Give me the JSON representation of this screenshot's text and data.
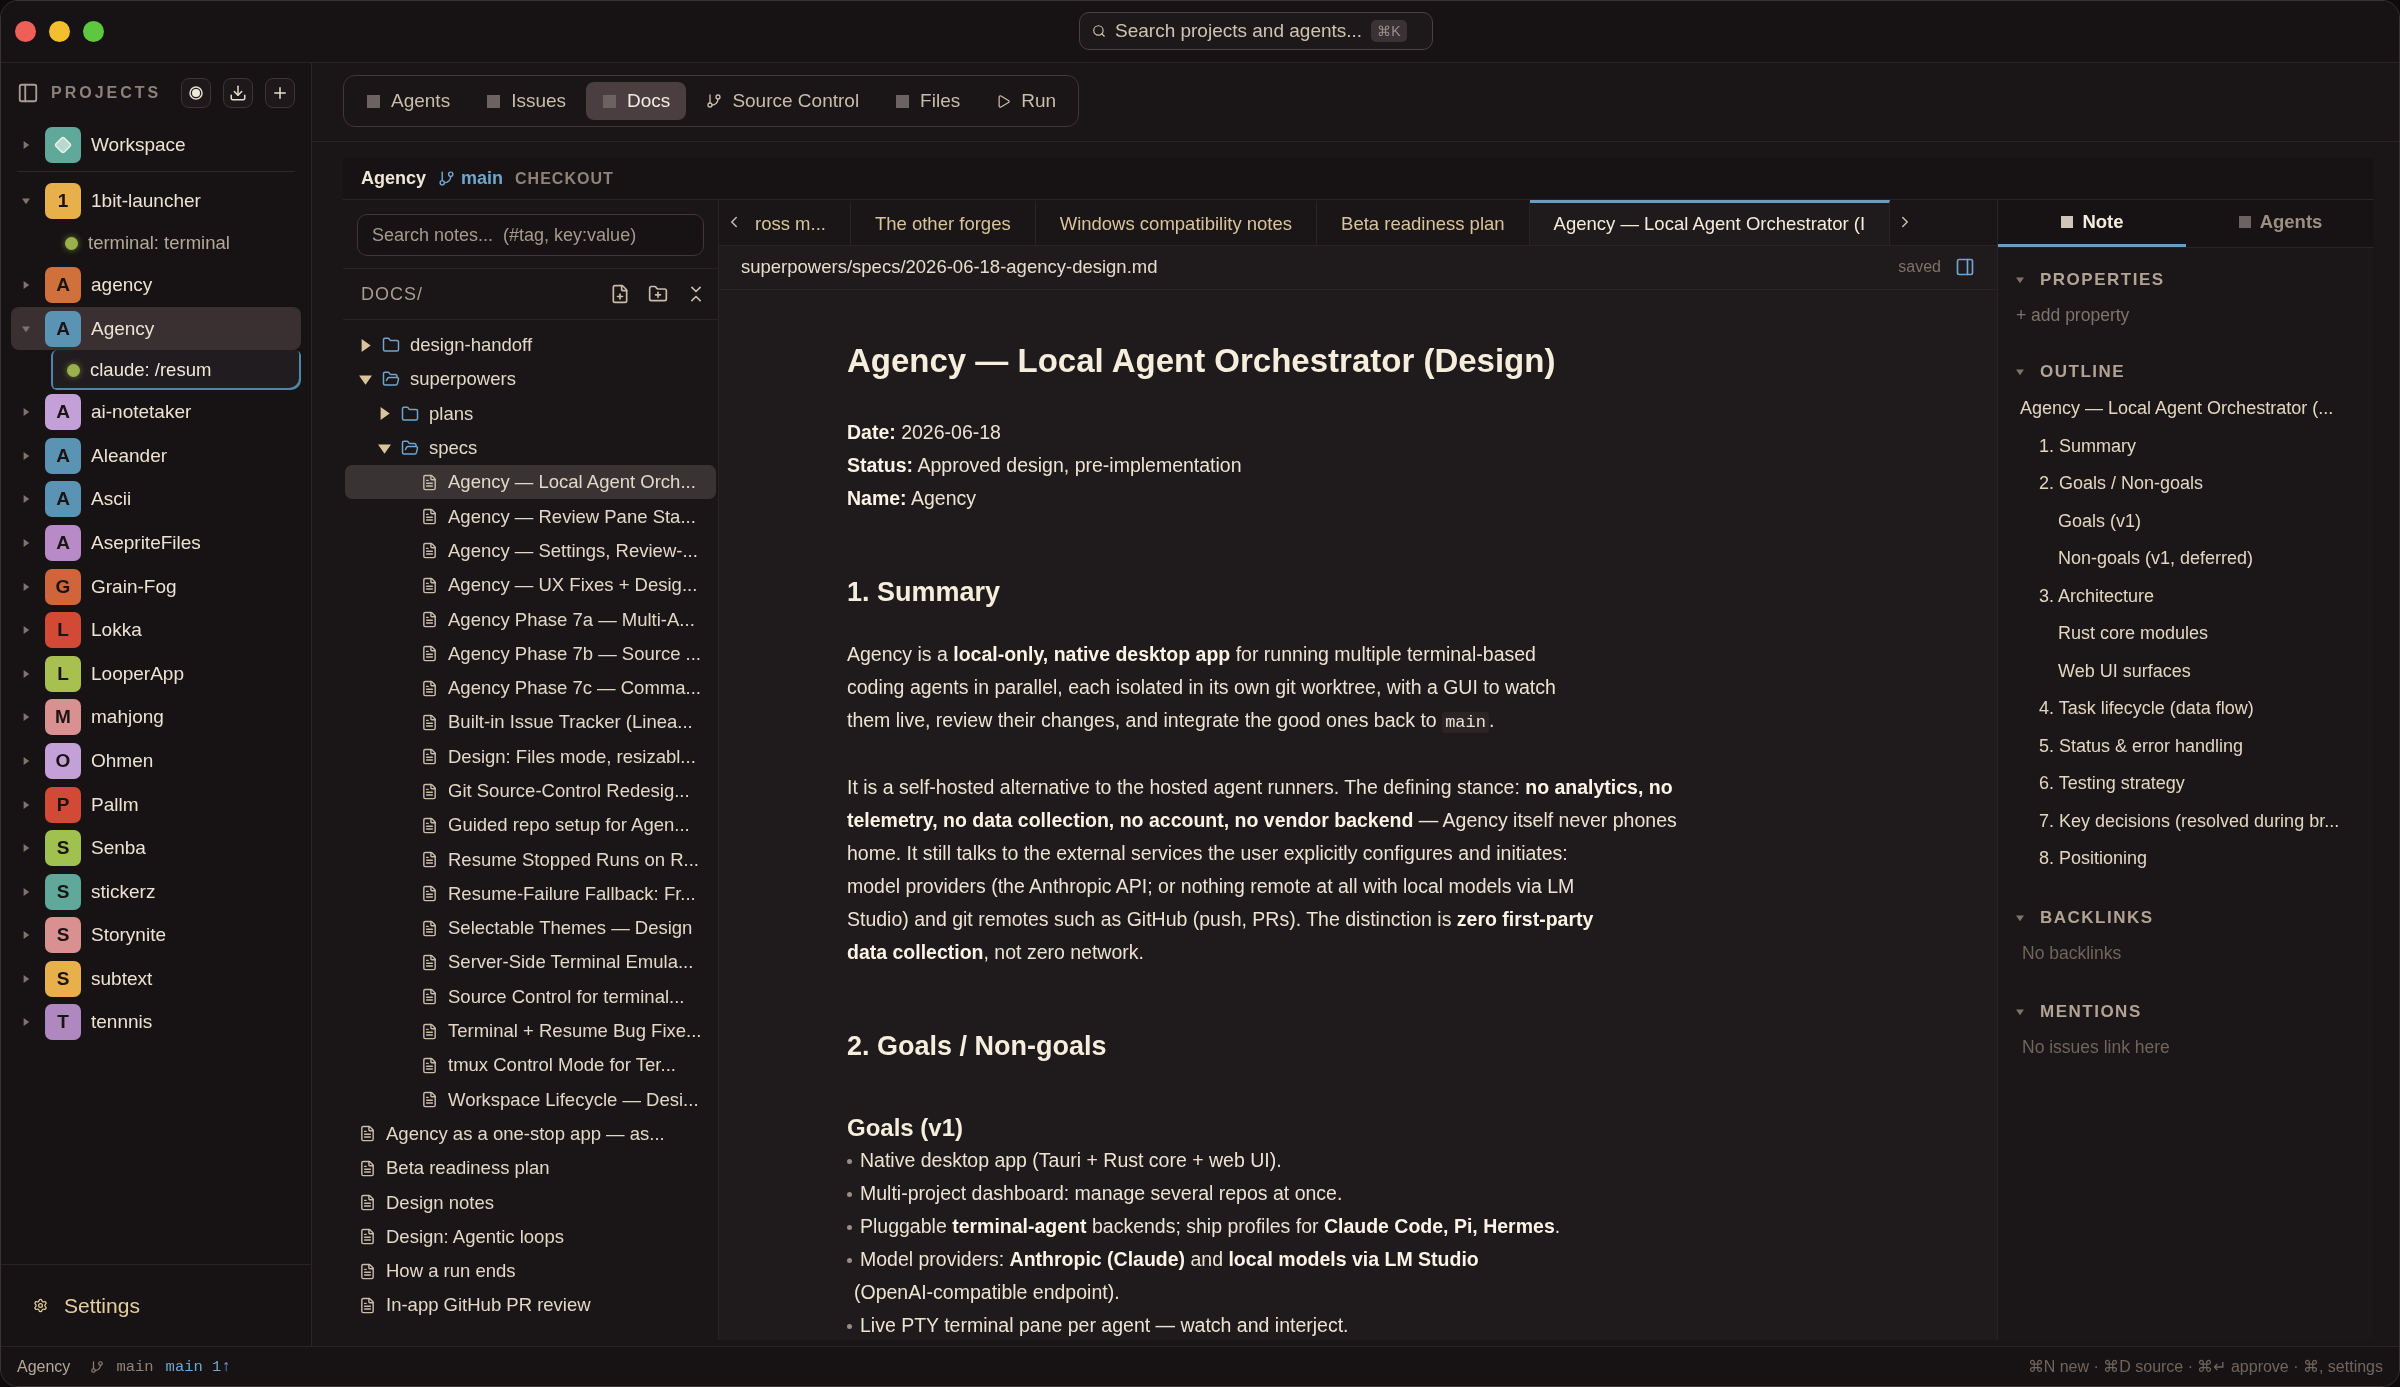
{
  "title_bar": {
    "search": {
      "placeholder": "Search projects and agents...",
      "shortcut": "⌘K"
    }
  },
  "sidebar": {
    "heading": "PROJECTS",
    "projects": [
      {
        "kind": "workspace",
        "name": "Workspace",
        "color": "#5fa89a",
        "expanded": false,
        "selected": false
      },
      {
        "kind": "project",
        "letter": "1",
        "name": "1bit-launcher",
        "color": "#e8b04a",
        "expanded": true,
        "selected": false,
        "children": [
          {
            "label": "terminal: terminal",
            "selected": false
          }
        ]
      },
      {
        "kind": "project",
        "letter": "A",
        "name": "agency",
        "color": "#d0703a",
        "expanded": false,
        "selected": false
      },
      {
        "kind": "project",
        "letter": "A",
        "name": "Agency",
        "color": "#5b93b5",
        "expanded": true,
        "selected": true,
        "children": [
          {
            "label": "claude: /resum",
            "selected": true
          }
        ]
      },
      {
        "kind": "project",
        "letter": "A",
        "name": "ai-notetaker",
        "color": "#c4a0d8",
        "expanded": false,
        "selected": false
      },
      {
        "kind": "project",
        "letter": "A",
        "name": "Aleander",
        "color": "#5b93b5",
        "expanded": false,
        "selected": false
      },
      {
        "kind": "project",
        "letter": "A",
        "name": "Ascii",
        "color": "#5b93b5",
        "expanded": false,
        "selected": false
      },
      {
        "kind": "project",
        "letter": "A",
        "name": "AsepriteFiles",
        "color": "#b88ac8",
        "expanded": false,
        "selected": false
      },
      {
        "kind": "project",
        "letter": "G",
        "name": "Grain-Fog",
        "color": "#d0643a",
        "expanded": false,
        "selected": false
      },
      {
        "kind": "project",
        "letter": "L",
        "name": "Lokka",
        "color": "#d24a35",
        "expanded": false,
        "selected": false
      },
      {
        "kind": "project",
        "letter": "L",
        "name": "LooperApp",
        "color": "#a8c050",
        "expanded": false,
        "selected": false
      },
      {
        "kind": "project",
        "letter": "M",
        "name": "mahjong",
        "color": "#d89090",
        "expanded": false,
        "selected": false
      },
      {
        "kind": "project",
        "letter": "O",
        "name": "Ohmen",
        "color": "#c4a0d8",
        "expanded": false,
        "selected": false
      },
      {
        "kind": "project",
        "letter": "P",
        "name": "Pallm",
        "color": "#d24a35",
        "expanded": false,
        "selected": false
      },
      {
        "kind": "project",
        "letter": "S",
        "name": "Senba",
        "color": "#a0c050",
        "expanded": false,
        "selected": false
      },
      {
        "kind": "project",
        "letter": "S",
        "name": "stickerz",
        "color": "#5fa89a",
        "expanded": false,
        "selected": false
      },
      {
        "kind": "project",
        "letter": "S",
        "name": "Storynite",
        "color": "#d89090",
        "expanded": false,
        "selected": false
      },
      {
        "kind": "project",
        "letter": "S",
        "name": "subtext",
        "color": "#e8b04a",
        "expanded": false,
        "selected": false
      },
      {
        "kind": "project",
        "letter": "T",
        "name": "tennnis",
        "color": "#b088c0",
        "expanded": false,
        "selected": false
      }
    ],
    "settings": "Settings"
  },
  "mode_tabs": [
    {
      "label": "Agents",
      "selected": false
    },
    {
      "label": "Issues",
      "selected": false
    },
    {
      "label": "Docs",
      "selected": true
    },
    {
      "label": "Source Control",
      "selected": false
    },
    {
      "label": "Files",
      "selected": false
    },
    {
      "label": "Run",
      "selected": false
    }
  ],
  "project_header": {
    "name": "Agency",
    "branch": "main",
    "action": "CHECKOUT"
  },
  "docs": {
    "search": {
      "placeholder": "Search notes...  (#tag, key:value)"
    },
    "heading": "DOCS/",
    "tree": [
      {
        "kind": "folder",
        "name": "design-handoff",
        "expanded": false
      },
      {
        "kind": "folder",
        "name": "superpowers",
        "expanded": true,
        "children": [
          {
            "kind": "folder",
            "name": "plans",
            "expanded": false
          },
          {
            "kind": "folder",
            "name": "specs",
            "expanded": true,
            "children": [
              {
                "kind": "file",
                "name": "Agency — Local Agent Orch...",
                "selected": true
              },
              {
                "kind": "file",
                "name": "Agency — Review Pane Sta...",
                "selected": false
              },
              {
                "kind": "file",
                "name": "Agency — Settings, Review-...",
                "selected": false
              },
              {
                "kind": "file",
                "name": "Agency — UX Fixes + Desig...",
                "selected": false
              },
              {
                "kind": "file",
                "name": "Agency Phase 7a — Multi-A...",
                "selected": false
              },
              {
                "kind": "file",
                "name": "Agency Phase 7b — Source ...",
                "selected": false
              },
              {
                "kind": "file",
                "name": "Agency Phase 7c — Comma...",
                "selected": false
              },
              {
                "kind": "file",
                "name": "Built-in Issue Tracker (Linea...",
                "selected": false
              },
              {
                "kind": "file",
                "name": "Design: Files mode, resizabl...",
                "selected": false
              },
              {
                "kind": "file",
                "name": "Git Source-Control Redesig...",
                "selected": false
              },
              {
                "kind": "file",
                "name": "Guided repo setup for Agen...",
                "selected": false
              },
              {
                "kind": "file",
                "name": "Resume Stopped Runs on R...",
                "selected": false
              },
              {
                "kind": "file",
                "name": "Resume-Failure Fallback: Fr...",
                "selected": false
              },
              {
                "kind": "file",
                "name": "Selectable Themes — Design",
                "selected": false
              },
              {
                "kind": "file",
                "name": "Server-Side Terminal Emula...",
                "selected": false
              },
              {
                "kind": "file",
                "name": "Source Control for terminal...",
                "selected": false
              },
              {
                "kind": "file",
                "name": "Terminal + Resume Bug Fixe...",
                "selected": false
              },
              {
                "kind": "file",
                "name": "tmux Control Mode for Ter...",
                "selected": false
              },
              {
                "kind": "file",
                "name": "Workspace Lifecycle — Desi...",
                "selected": false
              }
            ]
          }
        ]
      },
      {
        "kind": "file",
        "name": "Agency as a one-stop app — as...",
        "selected": false
      },
      {
        "kind": "file",
        "name": "Beta readiness plan",
        "selected": false
      },
      {
        "kind": "file",
        "name": "Design notes",
        "selected": false
      },
      {
        "kind": "file",
        "name": "Design: Agentic loops",
        "selected": false
      },
      {
        "kind": "file",
        "name": "How a run ends",
        "selected": false
      },
      {
        "kind": "file",
        "name": "In-app GitHub PR review",
        "selected": false
      }
    ]
  },
  "doc_tabs": [
    {
      "label": "ross m...",
      "selected": false
    },
    {
      "label": "The other forges",
      "selected": false
    },
    {
      "label": "Windows compatibility notes",
      "selected": false
    },
    {
      "label": "Beta readiness plan",
      "selected": false
    },
    {
      "label": "Agency — Local Agent Orchestrator (I",
      "selected": true
    }
  ],
  "editor": {
    "path": "superpowers/specs/2026-06-18-agency-design.md",
    "save_state": "saved",
    "blocks": [
      {
        "kind": "h1",
        "text": "Agency — Local Agent Orchestrator (Design)"
      },
      {
        "kind": "meta",
        "lines": [
          "**Date:** 2026-06-18",
          "**Status:** Approved design, pre-implementation",
          "**Name:** Agency"
        ]
      },
      {
        "kind": "h2",
        "text": "1. Summary"
      },
      {
        "kind": "paragraph",
        "lines": [
          [
            {
              "kind": "text",
              "text": "Agency is a **local-only, native desktop app** for running multiple terminal-based"
            }
          ],
          [
            {
              "kind": "text",
              "text": "coding agents in parallel, each isolated in its own git worktree, with a GUI to watch"
            }
          ],
          [
            {
              "kind": "text",
              "text": "them live, review their changes, and integrate the good ones back to "
            },
            {
              "kind": "code",
              "text": "main"
            },
            {
              "kind": "text",
              "text": "."
            }
          ]
        ]
      },
      {
        "kind": "paragraph",
        "lines": [
          [
            {
              "kind": "text",
              "text": "It is a self-hosted alternative to the hosted agent runners. The defining stance: **no analytics, no**"
            }
          ],
          [
            {
              "kind": "text",
              "text": "**telemetry, no data collection, no account, no vendor backend** — Agency itself never phones"
            }
          ],
          [
            {
              "kind": "text",
              "text": "home. It still talks to the external services the user explicitly configures and initiates:"
            }
          ],
          [
            {
              "kind": "text",
              "text": "model providers (the Anthropic API; or nothing remote at all with local models via LM"
            }
          ],
          [
            {
              "kind": "text",
              "text": "Studio) and git remotes such as GitHub (push, PRs). The distinction is **zero first-party**"
            }
          ],
          [
            {
              "kind": "text",
              "text": "**data collection**, not zero network."
            }
          ]
        ]
      },
      {
        "kind": "h2",
        "text": "2. Goals / Non-goals"
      },
      {
        "kind": "h3",
        "text": "Goals (v1)"
      },
      {
        "kind": "bullets",
        "items": [
          [
            "Native desktop app (Tauri + Rust core + web UI)."
          ],
          [
            "Multi-project dashboard: manage several repos at once."
          ],
          [
            "Pluggable **terminal-agent** backends; ship profiles for **Claude Code, Pi, Hermes**."
          ],
          [
            "Model providers: **Anthropic (Claude)** and **local models via LM Studio**",
            "(OpenAI-compatible endpoint)."
          ],
          [
            "Live PTY terminal pane per agent — watch and interject."
          ]
        ]
      }
    ]
  },
  "inspector": {
    "tabs": [
      {
        "label": "Note",
        "selected": true
      },
      {
        "label": "Agents",
        "selected": false
      }
    ],
    "sections": [
      {
        "kind": "properties",
        "title": "PROPERTIES",
        "action": "+ add property"
      },
      {
        "kind": "outline",
        "title": "OUTLINE",
        "items": [
          {
            "label": "Agency — Local Agent Orchestrator (...",
            "children": [
              {
                "label": "1. Summary"
              },
              {
                "label": "2. Goals / Non-goals",
                "children": [
                  {
                    "label": "Goals (v1)"
                  },
                  {
                    "label": "Non-goals (v1, deferred)"
                  }
                ]
              },
              {
                "label": "3. Architecture",
                "children": [
                  {
                    "label": "Rust core modules"
                  },
                  {
                    "label": "Web UI surfaces"
                  }
                ]
              },
              {
                "label": "4. Task lifecycle (data flow)"
              },
              {
                "label": "5. Status & error handling"
              },
              {
                "label": "6. Testing strategy"
              },
              {
                "label": "7. Key decisions (resolved during br..."
              },
              {
                "label": "8. Positioning"
              }
            ]
          }
        ]
      },
      {
        "kind": "empty",
        "title": "BACKLINKS",
        "note": "No backlinks"
      },
      {
        "kind": "empty",
        "title": "MENTIONS",
        "note": "No issues link here"
      }
    ]
  },
  "status_bar": {
    "project": "Agency",
    "branch": "main",
    "upstream": "main 1↑",
    "hints": "⌘N new · ⌘D source · ⌘↵ approve · ⌘, settings"
  }
}
